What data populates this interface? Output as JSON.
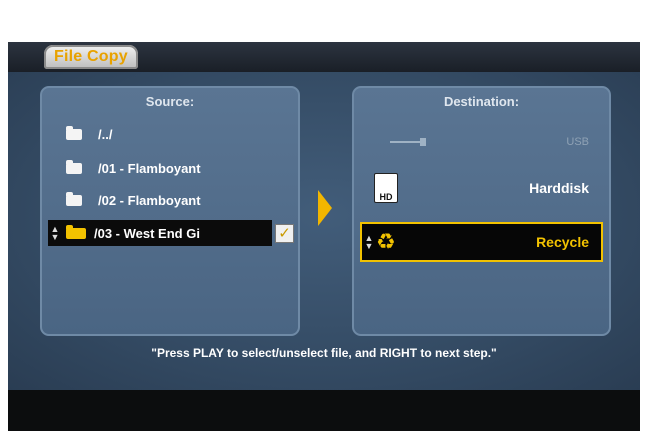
{
  "app": {
    "title": "File Copy"
  },
  "source": {
    "header": "Source:",
    "items": [
      {
        "label": "/../"
      },
      {
        "label": "/01 - Flamboyant"
      },
      {
        "label": "/02 - Flamboyant"
      },
      {
        "label": "/03 - West End Gi",
        "selected": true,
        "checked": true
      }
    ],
    "check_mark": "✓"
  },
  "destination": {
    "header": "Destination:",
    "items": [
      {
        "label": "USB",
        "icon": "usb-icon",
        "enabled": false
      },
      {
        "label": "Harddisk",
        "icon": "harddisk-icon",
        "badge": "HD"
      },
      {
        "label": "Recycle",
        "icon": "recycle-icon",
        "selected": true
      }
    ]
  },
  "hint": "\"Press PLAY to select/unselect file, and RIGHT to next step.\"",
  "colors": {
    "accent": "#f2c200",
    "panel": "#4a6583",
    "background": "#344b64"
  }
}
